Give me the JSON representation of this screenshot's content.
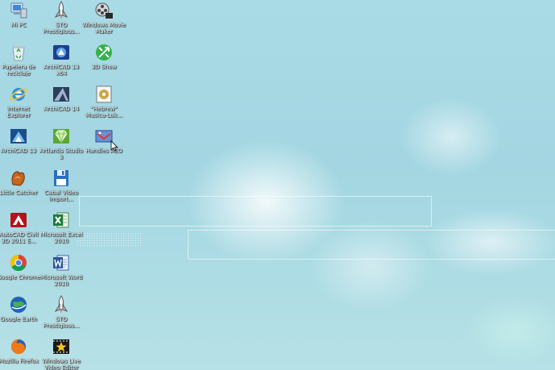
{
  "desktop": {
    "icons": [
      {
        "label": "Mi PC",
        "icon": "computer-icon"
      },
      {
        "label": "STO Prestigious...",
        "icon": "shuttle-icon"
      },
      {
        "label": "Windows Movie Maker",
        "icon": "film-reel-icon"
      },
      {
        "label": "Papelera de reciclaje",
        "icon": "recycle-bin-icon"
      },
      {
        "label": "ArchiCAD 13 x64",
        "icon": "archicad-icon"
      },
      {
        "label": "3D Show",
        "icon": "green-arrow-icon"
      },
      {
        "label": "Internet Explorer",
        "icon": "ie-icon"
      },
      {
        "label": "ArchiCAD 14",
        "icon": "archicad-triangle-icon"
      },
      {
        "label": "\"Hebrew\" Musica-Luk...",
        "icon": "music-disc-icon"
      },
      {
        "label": "ArchiCAD 13",
        "icon": "archicad-blue-icon"
      },
      {
        "label": "Artlantis Studio 3",
        "icon": "gem-icon"
      },
      {
        "label": "Handles AEO",
        "icon": "handles-icon"
      },
      {
        "label": "Little Catcher",
        "icon": "glove-icon"
      },
      {
        "label": "Cabal Video Import...",
        "icon": "floppy-icon"
      },
      {
        "label": "AutoCAD Civil 3D 2011 E...",
        "icon": "autocad-icon"
      },
      {
        "label": "Microsoft Excel 2010",
        "icon": "excel-icon"
      },
      {
        "label": "Google Chrome",
        "icon": "chrome-icon"
      },
      {
        "label": "Microsoft Word 2010",
        "icon": "word-icon"
      },
      {
        "label": "Google Earth",
        "icon": "globe-icon"
      },
      {
        "label": "STO Prestigious...",
        "icon": "shuttle-icon"
      },
      {
        "label": "Mozilla Firefox",
        "icon": "firefox-icon"
      },
      {
        "label": "Windows Live Video Editor",
        "icon": "movie-star-icon"
      }
    ]
  },
  "colors": {
    "background": "#a9dbe6",
    "label_text": "#ffffff"
  }
}
